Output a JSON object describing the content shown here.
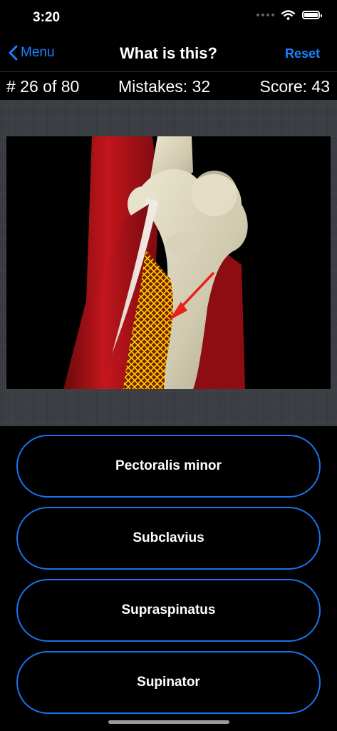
{
  "status_bar": {
    "time": "3:20"
  },
  "nav": {
    "back_label": "Menu",
    "title": "What is this?",
    "reset_label": "Reset"
  },
  "stats": {
    "progress": "# 26 of 80",
    "mistakes": "Mistakes: 32",
    "score": "Score: 43"
  },
  "image": {
    "icons": [
      "red-arrow-pointer",
      "highlight-hatch"
    ]
  },
  "answers": [
    {
      "label": "Pectoralis minor"
    },
    {
      "label": "Subclavius"
    },
    {
      "label": "Supraspinatus"
    },
    {
      "label": "Supinator"
    }
  ],
  "colors": {
    "accent": "#1a82ff",
    "button_border": "#1a73e8",
    "highlight": "#f5d200",
    "arrow": "#e8221b"
  }
}
